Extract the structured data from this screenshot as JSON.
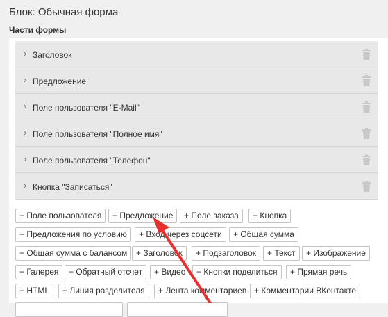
{
  "block_title": "Блок: Обычная форма",
  "section_label": "Части формы",
  "parts": [
    {
      "label": "Заголовок"
    },
    {
      "label": "Предложение"
    },
    {
      "label": "Поле пользователя \"E-Mail\""
    },
    {
      "label": "Поле пользователя \"Полное имя\""
    },
    {
      "label": "Поле пользователя \"Телефон\""
    },
    {
      "label": "Кнопка \"Записаться\""
    }
  ],
  "icons": {
    "expand": "chevron-right-icon",
    "delete": "trash-icon"
  },
  "add_buttons": {
    "row1": [
      "+ Поле пользователя",
      "+ Предложение",
      "+ Поле заказа",
      "+ Кнопка"
    ],
    "row2": [
      "+ Предложения по условию",
      "+ Вход через соцсети",
      "+ Общая сумма"
    ],
    "row3": [
      "+ Общая сумма с балансом",
      "+ Заголовок",
      "+ Подзаголовок",
      "+ Текст",
      "+ Изображение"
    ],
    "row4": [
      "+ Галерея",
      "+ Обратный отсчет",
      "+ Видео",
      "+ Кнопки поделиться",
      "+ Прямая речь"
    ],
    "row5": [
      "+ HTML",
      "+ Линия разделителя",
      "+ Лента комментариев",
      "+ Комментарии ВКонтакте"
    ]
  },
  "colors": {
    "annotation_arrow": "#e8312f"
  }
}
